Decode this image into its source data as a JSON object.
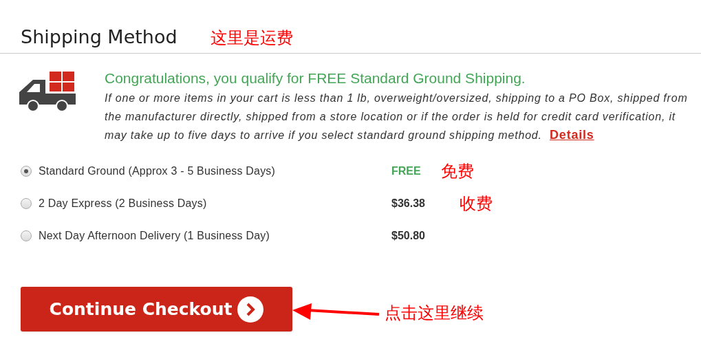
{
  "section": {
    "title": "Shipping Method",
    "annotation": "这里是运费"
  },
  "notice": {
    "headline": "Congratulations, you qualify for FREE Standard Ground Shipping.",
    "body": "If one or more items in your cart is less than 1 lb, overweight/oversized, shipping to a PO Box, shipped from the manufacturer directly, shipped from a store location or if the order is held for credit card verification, it may take up to five days to arrive if you select standard ground shipping method.",
    "link": "Details"
  },
  "options": [
    {
      "label": "Standard Ground (Approx 3 - 5 Business Days)",
      "price": "FREE",
      "kind": "free",
      "selected": true,
      "annotation": "免费"
    },
    {
      "label": "2 Day Express (2 Business Days)",
      "price": "$36.38",
      "kind": "paid",
      "selected": false,
      "annotation": "收费"
    },
    {
      "label": "Next Day Afternoon Delivery (1 Business Day)",
      "price": "$50.80",
      "kind": "paid",
      "selected": false
    }
  ],
  "button": {
    "label": "Continue Checkout"
  },
  "callout": {
    "text": "点击这里继续"
  }
}
